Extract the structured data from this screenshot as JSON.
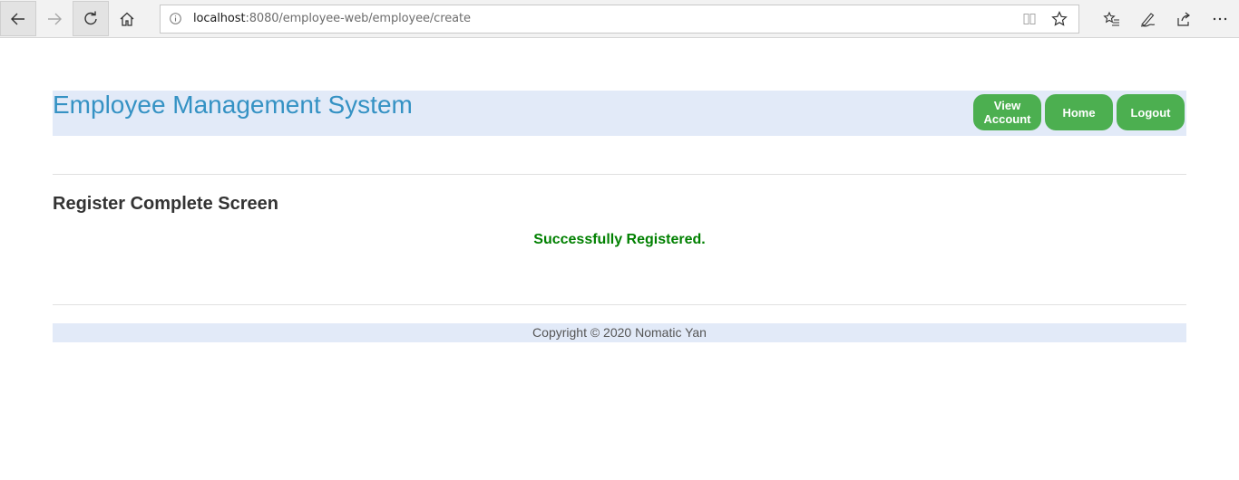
{
  "browser": {
    "url_host": "localhost",
    "url_rest": ":8080/employee-web/employee/create"
  },
  "header": {
    "title": "Employee Management System",
    "nav": [
      {
        "label": "View Account"
      },
      {
        "label": "Home"
      },
      {
        "label": "Logout"
      }
    ]
  },
  "main": {
    "page_title": "Register Complete Screen",
    "message": "Successfully Registered."
  },
  "footer": {
    "copyright": "Copyright © 2020 Nomatic Yan"
  },
  "colors": {
    "header_bg": "#e2eaf8",
    "title": "#3592c4",
    "button": "#4caf50",
    "success": "#008000"
  },
  "icons": [
    "back-icon",
    "forward-icon",
    "refresh-icon",
    "home-icon",
    "info-icon",
    "reading-view-icon",
    "favorite-star-icon",
    "favorites-list-icon",
    "pen-icon",
    "share-icon",
    "more-icon"
  ]
}
